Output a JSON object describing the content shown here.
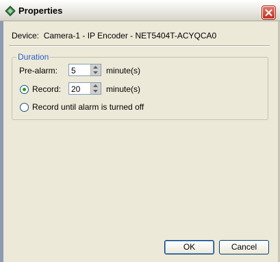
{
  "window": {
    "title": "Properties",
    "icon": "diamond-app-icon",
    "close_icon": "close-icon"
  },
  "device": {
    "label": "Device:",
    "value": "Camera-1 - IP Encoder - NET5404T-ACYQCA0"
  },
  "duration": {
    "legend": "Duration",
    "pre_alarm": {
      "label": "Pre-alarm:",
      "value": "5",
      "unit": "minute(s)"
    },
    "record": {
      "label": "Record:",
      "value": "20",
      "unit": "minute(s)",
      "selected": true
    },
    "record_until": {
      "label": "Record until alarm is turned off",
      "selected": false
    }
  },
  "buttons": {
    "ok": "OK",
    "cancel": "Cancel"
  },
  "colors": {
    "legend": "#2a5fc8",
    "radio_dot": "#21a121",
    "close": "#c2301e"
  }
}
